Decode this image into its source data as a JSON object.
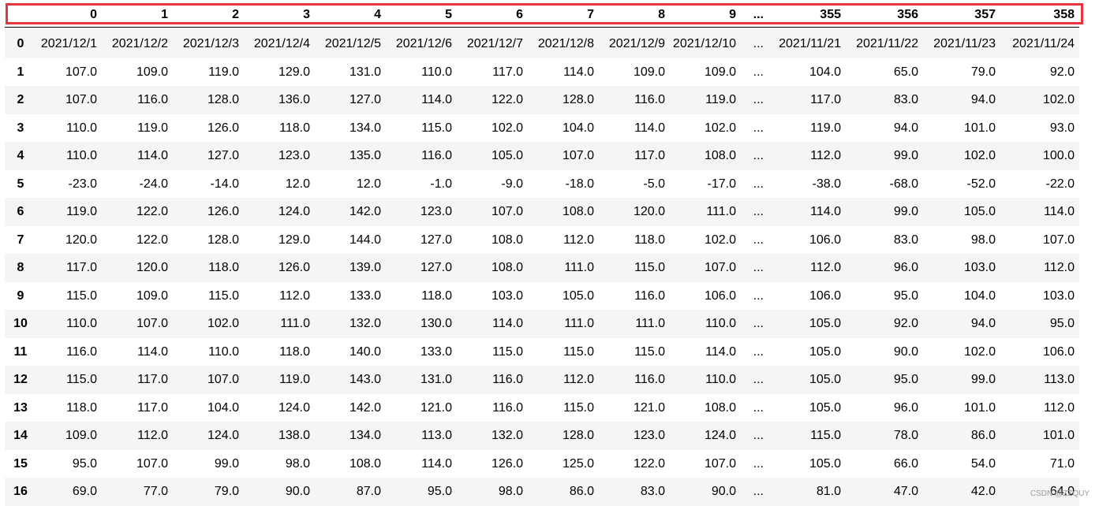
{
  "table": {
    "columns": [
      "",
      "0",
      "1",
      "2",
      "3",
      "4",
      "5",
      "6",
      "7",
      "8",
      "9",
      "...",
      "355",
      "356",
      "357",
      "358"
    ],
    "rows": [
      {
        "index": "0",
        "cells": [
          "2021/12/1",
          "2021/12/2",
          "2021/12/3",
          "2021/12/4",
          "2021/12/5",
          "2021/12/6",
          "2021/12/7",
          "2021/12/8",
          "2021/12/9",
          "2021/12/10",
          "...",
          "2021/11/21",
          "2021/11/22",
          "2021/11/23",
          "2021/11/24"
        ]
      },
      {
        "index": "1",
        "cells": [
          "107.0",
          "109.0",
          "119.0",
          "129.0",
          "131.0",
          "110.0",
          "117.0",
          "114.0",
          "109.0",
          "109.0",
          "...",
          "104.0",
          "65.0",
          "79.0",
          "92.0"
        ]
      },
      {
        "index": "2",
        "cells": [
          "107.0",
          "116.0",
          "128.0",
          "136.0",
          "127.0",
          "114.0",
          "122.0",
          "128.0",
          "116.0",
          "119.0",
          "...",
          "117.0",
          "83.0",
          "94.0",
          "102.0"
        ]
      },
      {
        "index": "3",
        "cells": [
          "110.0",
          "119.0",
          "126.0",
          "118.0",
          "134.0",
          "115.0",
          "102.0",
          "104.0",
          "114.0",
          "102.0",
          "...",
          "119.0",
          "94.0",
          "101.0",
          "93.0"
        ]
      },
      {
        "index": "4",
        "cells": [
          "110.0",
          "114.0",
          "127.0",
          "123.0",
          "135.0",
          "116.0",
          "105.0",
          "107.0",
          "117.0",
          "108.0",
          "...",
          "112.0",
          "99.0",
          "102.0",
          "100.0"
        ]
      },
      {
        "index": "5",
        "cells": [
          "-23.0",
          "-24.0",
          "-14.0",
          "12.0",
          "12.0",
          "-1.0",
          "-9.0",
          "-18.0",
          "-5.0",
          "-17.0",
          "...",
          "-38.0",
          "-68.0",
          "-52.0",
          "-22.0"
        ]
      },
      {
        "index": "6",
        "cells": [
          "119.0",
          "122.0",
          "126.0",
          "124.0",
          "142.0",
          "123.0",
          "107.0",
          "108.0",
          "120.0",
          "111.0",
          "...",
          "114.0",
          "99.0",
          "105.0",
          "114.0"
        ]
      },
      {
        "index": "7",
        "cells": [
          "120.0",
          "122.0",
          "128.0",
          "129.0",
          "144.0",
          "127.0",
          "108.0",
          "112.0",
          "118.0",
          "102.0",
          "...",
          "106.0",
          "83.0",
          "98.0",
          "107.0"
        ]
      },
      {
        "index": "8",
        "cells": [
          "117.0",
          "120.0",
          "118.0",
          "126.0",
          "139.0",
          "127.0",
          "108.0",
          "111.0",
          "115.0",
          "107.0",
          "...",
          "112.0",
          "96.0",
          "103.0",
          "112.0"
        ]
      },
      {
        "index": "9",
        "cells": [
          "115.0",
          "109.0",
          "115.0",
          "112.0",
          "133.0",
          "118.0",
          "103.0",
          "105.0",
          "116.0",
          "106.0",
          "...",
          "106.0",
          "95.0",
          "104.0",
          "103.0"
        ]
      },
      {
        "index": "10",
        "cells": [
          "110.0",
          "107.0",
          "102.0",
          "111.0",
          "132.0",
          "130.0",
          "114.0",
          "111.0",
          "111.0",
          "110.0",
          "...",
          "105.0",
          "92.0",
          "94.0",
          "95.0"
        ]
      },
      {
        "index": "11",
        "cells": [
          "116.0",
          "114.0",
          "110.0",
          "118.0",
          "140.0",
          "133.0",
          "115.0",
          "115.0",
          "115.0",
          "114.0",
          "...",
          "105.0",
          "90.0",
          "102.0",
          "106.0"
        ]
      },
      {
        "index": "12",
        "cells": [
          "115.0",
          "117.0",
          "107.0",
          "119.0",
          "143.0",
          "131.0",
          "116.0",
          "112.0",
          "116.0",
          "110.0",
          "...",
          "105.0",
          "95.0",
          "99.0",
          "113.0"
        ]
      },
      {
        "index": "13",
        "cells": [
          "118.0",
          "117.0",
          "104.0",
          "124.0",
          "142.0",
          "121.0",
          "116.0",
          "115.0",
          "121.0",
          "108.0",
          "...",
          "105.0",
          "96.0",
          "101.0",
          "112.0"
        ]
      },
      {
        "index": "14",
        "cells": [
          "109.0",
          "112.0",
          "124.0",
          "138.0",
          "134.0",
          "113.0",
          "132.0",
          "128.0",
          "123.0",
          "124.0",
          "...",
          "115.0",
          "78.0",
          "86.0",
          "101.0"
        ]
      },
      {
        "index": "15",
        "cells": [
          "95.0",
          "107.0",
          "99.0",
          "98.0",
          "108.0",
          "114.0",
          "126.0",
          "125.0",
          "122.0",
          "107.0",
          "...",
          "105.0",
          "66.0",
          "54.0",
          "71.0"
        ]
      },
      {
        "index": "16",
        "cells": [
          "69.0",
          "77.0",
          "79.0",
          "90.0",
          "87.0",
          "95.0",
          "98.0",
          "86.0",
          "83.0",
          "90.0",
          "...",
          "81.0",
          "47.0",
          "42.0",
          "64.0"
        ]
      }
    ]
  },
  "highlight_color": "#e8343b",
  "watermark": "CSDN @ZZQUY"
}
